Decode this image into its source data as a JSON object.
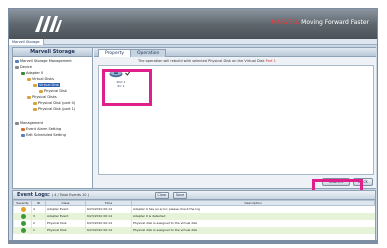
{
  "header": {
    "brand_prefix": "MARVELL",
    "brand_suffix": "Moving Forward Faster",
    "accent_color": "#ff3333"
  },
  "nav": {
    "tab_label": "Marvell Storage"
  },
  "left_panel": {
    "title": "Marvell Storage",
    "tree": [
      "Marvell Storage Management",
      "Device",
      "Adapter 0",
      "Virtual Disks",
      "Virtual Disk",
      "Physical Disk",
      "Physical Disks",
      "Physical Disk (port 0)",
      "Physical Disk (port 1)",
      "Management",
      "Event Alarm Setting",
      "Edit Scheduled Setting"
    ]
  },
  "tabs": {
    "property": "Property",
    "second": "Operation"
  },
  "content": {
    "info_prefix": "The operation will rebuild with selected Physical Disk on the Virtual Disk",
    "info_highlight": "Port 1",
    "disk_label_line1": "Port 1",
    "disk_label_line2": "ID: 1"
  },
  "buttons": {
    "apply": "Submit",
    "second": "Back"
  },
  "event_log": {
    "title": "Event Logs:",
    "count": "( 4 / Total Events 10 )",
    "buttons": [
      "Clear",
      "Save"
    ],
    "columns": [
      "Severity",
      "ID",
      "Class",
      "Time",
      "Description"
    ],
    "rows": [
      {
        "severity": "warning",
        "id": "4",
        "class": "Adapter Event",
        "time": "6/23/2010 00:14",
        "description": "Adapter 0 has an error; please check the log"
      },
      {
        "severity": "info",
        "id": "3",
        "class": "Adapter Event",
        "time": "6/23/2010 00:14",
        "description": "Adapter 0 is detected"
      },
      {
        "severity": "info",
        "id": "2",
        "class": "Physical Disk",
        "time": "6/23/2010 00:14",
        "description": "Physical disk is assigned to the virtual disk"
      },
      {
        "severity": "info",
        "id": "1",
        "class": "Physical Disk",
        "time": "6/23/2010 00:14",
        "description": "Physical disk is assigned to the virtual disk"
      }
    ]
  },
  "colors": {
    "highlight": "#e0208a",
    "warning": "#e8a020",
    "info": "#3a9a3a"
  }
}
